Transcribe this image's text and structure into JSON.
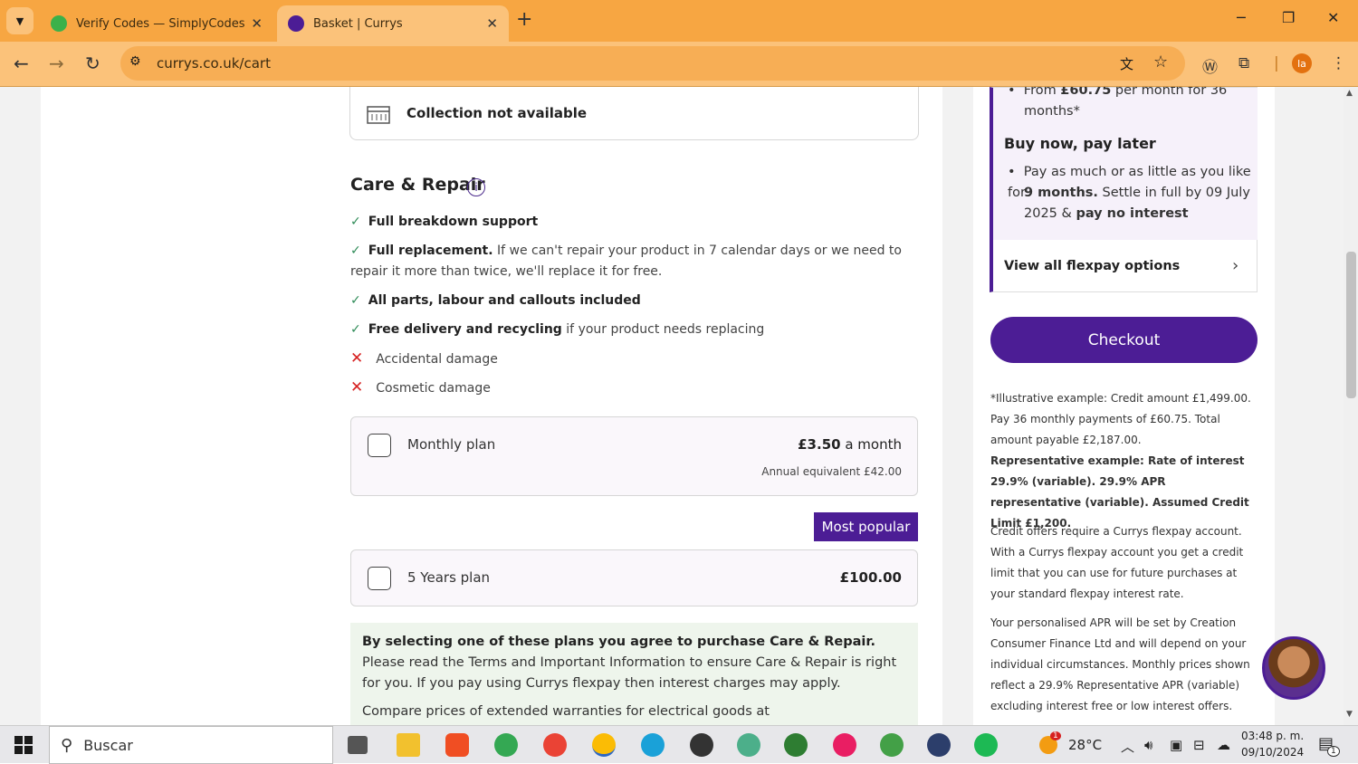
{
  "browser": {
    "tabs": [
      {
        "title": "Verify Codes — SimplyCodes",
        "close": "✕"
      },
      {
        "title": "Basket | Currys",
        "close": "✕"
      }
    ],
    "new_tab": "+",
    "url": "currys.co.uk/cart",
    "profile_initials": "la"
  },
  "collection": {
    "text": "Collection not available"
  },
  "care": {
    "title": "Care & Repair",
    "info": "i",
    "features": [
      {
        "bold": "Full breakdown support",
        "rest": ""
      },
      {
        "bold": "Full replacement.",
        "rest": " If we can't repair your product in 7 calendar days or we need to repair it more than twice, we'll replace it for free."
      },
      {
        "bold": "All parts, labour and callouts included",
        "rest": ""
      },
      {
        "bold": "Free delivery and recycling",
        "rest": " if your product needs replacing"
      }
    ],
    "exclusions": [
      "Accidental damage",
      "Cosmetic damage"
    ],
    "monthly_plan": {
      "name": "Monthly plan",
      "price": "£3.50",
      "period": " a month",
      "annual": "Annual equivalent £42.00"
    },
    "popular_badge": "Most popular",
    "five_year_plan": {
      "name": "5 Years plan",
      "price": "£100.00"
    },
    "agreement": {
      "bold": "By selecting one of these plans you agree to purchase Care & Repair.",
      "rest": " Please read the Terms and Important Information to ensure Care & Repair is right for you. If you pay using Currys flexpay then interest charges may apply.",
      "compare": "Compare prices of extended warranties for electrical goods at"
    }
  },
  "flexpay": {
    "from_prefix": "From ",
    "from_amount": "£60.75",
    "from_suffix": " per month for 36",
    "months_line": "months*",
    "bnpl_title": "Buy now, pay later",
    "bnpl_l1": "Pay as much or as little as you like for",
    "bnpl_l2_bold": "9 months.",
    "bnpl_l2_rest": " Settle in full by 09 July",
    "bnpl_l3_a": "2025 & ",
    "bnpl_l3_bold": "pay no interest",
    "view_all": "View all flexpay options"
  },
  "checkout": {
    "label": "Checkout"
  },
  "legal": {
    "illustrative": "*Illustrative example: Credit amount £1,499.00. Pay 36 monthly payments of £60.75. Total amount payable £2,187.00.",
    "representative": "Representative example: Rate of interest 29.9% (variable). 29.9% APR representative (variable). Assumed Credit Limit £1,200.",
    "credit_offers": "Credit offers require a Currys flexpay account. With a Currys flexpay account you get a credit limit that you can use for future purchases at your standard flexpay interest rate.",
    "personalised": "Your personalised APR will be set by Creation Consumer Finance Ltd and will depend on your individual circumstances. Monthly prices shown reflect a 29.9% Representative APR (variable) excluding interest free or low interest offers."
  },
  "taskbar": {
    "search": "Buscar",
    "temperature": "28°C",
    "time": "03:48 p. m.",
    "date": "09/10/2024",
    "weather_badge": "1",
    "notif_badge": "1"
  },
  "colors": {
    "brand": "#4c1d95",
    "tab_bar": "#f7a642",
    "check": "#2e8b57",
    "cross": "#d62020"
  }
}
